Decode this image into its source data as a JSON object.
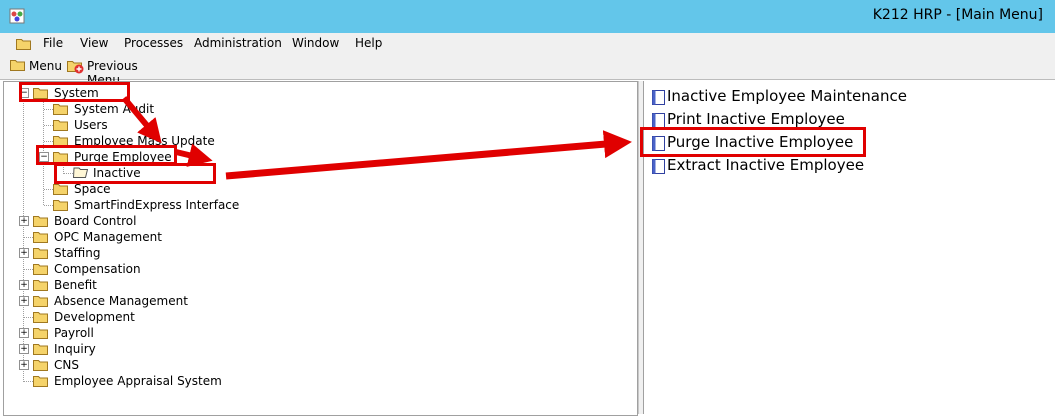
{
  "window": {
    "title": "K212 HRP - [Main Menu]"
  },
  "menubar": {
    "items": [
      "File",
      "View",
      "Processes",
      "Administration",
      "Window",
      "Help"
    ]
  },
  "toolbar": {
    "menu_label": "Menu",
    "previous_label": "Previous Menu"
  },
  "tree": {
    "system": {
      "label": "System",
      "children": [
        "System Audit",
        "Users",
        "Employee Mass Update",
        "Purge Employee",
        "Space",
        "SmartFindExpress Interface"
      ],
      "purge_child": "Inactive"
    },
    "roots": [
      "Board Control",
      "OPC Management",
      "Staffing",
      "Compensation",
      "Benefit",
      "Absence Management",
      "Development",
      "Payroll",
      "Inquiry",
      "CNS",
      "Employee Appraisal System"
    ]
  },
  "list": {
    "items": [
      "Inactive Employee Maintenance",
      "Print Inactive Employee",
      "Purge Inactive Employee",
      "Extract Inactive Employee"
    ]
  },
  "colors": {
    "titlebar": "#63c6ea",
    "highlight": "#e00000",
    "folder": "#f5d36a"
  },
  "icons": {
    "folder": "folder-icon",
    "open_folder": "open-folder-icon",
    "document": "document-icon",
    "app": "app-icon",
    "previous": "previous-menu-icon"
  }
}
